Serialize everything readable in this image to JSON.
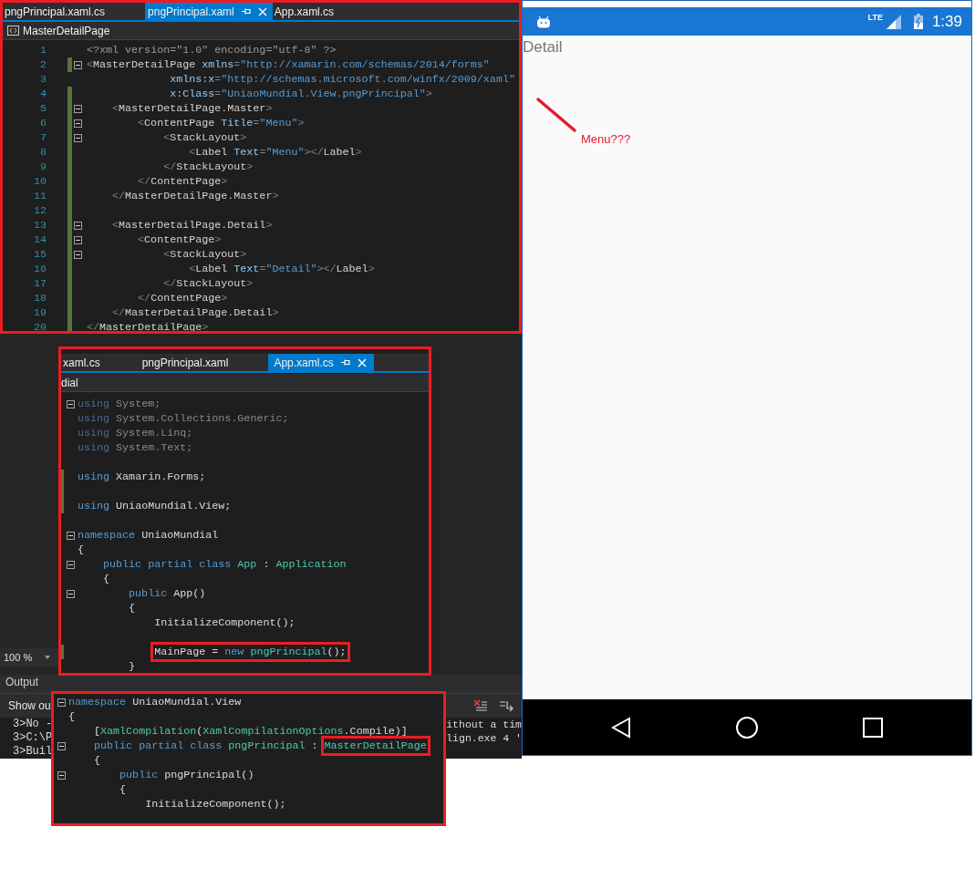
{
  "editors": [
    {
      "tabs": [
        {
          "label": "pngPrincipal.xaml.cs",
          "selected": false
        },
        {
          "label": "pngPrincipal.xaml",
          "selected": true
        },
        {
          "label": "App.xaml.cs",
          "selected": false
        }
      ],
      "breadcrumb": {
        "label": "MasterDetailPage",
        "icon": true
      },
      "lines": [
        {
          "number": "1",
          "fold": false,
          "changed": false,
          "tokens": [
            {
              "kind": "decl",
              "text": "<?xml version=\"1.0\" encoding=\"utf-8\" ?>"
            }
          ]
        },
        {
          "number": "2",
          "fold": true,
          "changed": true,
          "tokens": [
            {
              "kind": "punct",
              "text": "<"
            },
            {
              "kind": "tag",
              "text": "MasterDetailPage"
            },
            {
              "kind": "attr",
              "text": " xmlns"
            },
            {
              "kind": "punct",
              "text": "="
            },
            {
              "kind": "string",
              "text": "\"http://xamarin.com/schemas/2014/forms\""
            }
          ]
        },
        {
          "number": "3",
          "fold": false,
          "changed": false,
          "tokens": [
            {
              "kind": "attr",
              "text": "             xmlns:x"
            },
            {
              "kind": "punct",
              "text": "="
            },
            {
              "kind": "string",
              "text": "\"http://schemas.microsoft.com/winfx/2009/xaml\""
            }
          ]
        },
        {
          "number": "4",
          "fold": false,
          "changed": true,
          "tokens": [
            {
              "kind": "attr",
              "text": "             x:Class"
            },
            {
              "kind": "punct",
              "text": "="
            },
            {
              "kind": "string",
              "text": "\"UniaoMundial.View.pngPrincipal\""
            },
            {
              "kind": "punct",
              "text": ">"
            }
          ]
        },
        {
          "number": "5",
          "fold": true,
          "changed": true,
          "tokens": [
            {
              "kind": "punct",
              "text": "    <"
            },
            {
              "kind": "tag",
              "text": "MasterDetailPage.Master"
            },
            {
              "kind": "punct",
              "text": ">"
            }
          ]
        },
        {
          "number": "6",
          "fold": true,
          "changed": true,
          "tokens": [
            {
              "kind": "punct",
              "text": "        <"
            },
            {
              "kind": "tag",
              "text": "ContentPage"
            },
            {
              "kind": "attr",
              "text": " Title"
            },
            {
              "kind": "punct",
              "text": "="
            },
            {
              "kind": "string",
              "text": "\"Menu\""
            },
            {
              "kind": "punct",
              "text": ">"
            }
          ]
        },
        {
          "number": "7",
          "fold": true,
          "changed": true,
          "tokens": [
            {
              "kind": "punct",
              "text": "            <"
            },
            {
              "kind": "tag",
              "text": "StackLayout"
            },
            {
              "kind": "punct",
              "text": ">"
            }
          ]
        },
        {
          "number": "8",
          "fold": false,
          "changed": true,
          "tokens": [
            {
              "kind": "punct",
              "text": "                <"
            },
            {
              "kind": "tag",
              "text": "Label"
            },
            {
              "kind": "attr",
              "text": " Text"
            },
            {
              "kind": "punct",
              "text": "="
            },
            {
              "kind": "string",
              "text": "\"Menu\""
            },
            {
              "kind": "punct",
              "text": "></"
            },
            {
              "kind": "tag",
              "text": "Label"
            },
            {
              "kind": "punct",
              "text": ">"
            }
          ]
        },
        {
          "number": "9",
          "fold": false,
          "changed": true,
          "tokens": [
            {
              "kind": "punct",
              "text": "            </"
            },
            {
              "kind": "tag",
              "text": "StackLayout"
            },
            {
              "kind": "punct",
              "text": ">"
            }
          ]
        },
        {
          "number": "10",
          "fold": false,
          "changed": true,
          "tokens": [
            {
              "kind": "punct",
              "text": "        </"
            },
            {
              "kind": "tag",
              "text": "ContentPage"
            },
            {
              "kind": "punct",
              "text": ">"
            }
          ]
        },
        {
          "number": "11",
          "fold": false,
          "changed": true,
          "tokens": [
            {
              "kind": "punct",
              "text": "    </"
            },
            {
              "kind": "tag",
              "text": "MasterDetailPage.Master"
            },
            {
              "kind": "punct",
              "text": ">"
            }
          ]
        },
        {
          "number": "12",
          "fold": false,
          "changed": true
        },
        {
          "number": "13",
          "fold": true,
          "changed": true,
          "tokens": [
            {
              "kind": "punct",
              "text": "    <"
            },
            {
              "kind": "tag",
              "text": "MasterDetailPage.Detail"
            },
            {
              "kind": "punct",
              "text": ">"
            }
          ]
        },
        {
          "number": "14",
          "fold": true,
          "changed": true,
          "tokens": [
            {
              "kind": "punct",
              "text": "        <"
            },
            {
              "kind": "tag",
              "text": "ContentPage"
            },
            {
              "kind": "punct",
              "text": ">"
            }
          ]
        },
        {
          "number": "15",
          "fold": true,
          "changed": true,
          "tokens": [
            {
              "kind": "punct",
              "text": "            <"
            },
            {
              "kind": "tag",
              "text": "StackLayout"
            },
            {
              "kind": "punct",
              "text": ">"
            }
          ]
        },
        {
          "number": "16",
          "fold": false,
          "changed": true,
          "tokens": [
            {
              "kind": "punct",
              "text": "                <"
            },
            {
              "kind": "tag",
              "text": "Label"
            },
            {
              "kind": "attr",
              "text": " Text"
            },
            {
              "kind": "punct",
              "text": "="
            },
            {
              "kind": "string",
              "text": "\"Detail\""
            },
            {
              "kind": "punct",
              "text": "></"
            },
            {
              "kind": "tag",
              "text": "Label"
            },
            {
              "kind": "punct",
              "text": ">"
            }
          ]
        },
        {
          "number": "17",
          "fold": false,
          "changed": true,
          "tokens": [
            {
              "kind": "punct",
              "text": "            </"
            },
            {
              "kind": "tag",
              "text": "StackLayout"
            },
            {
              "kind": "punct",
              "text": ">"
            }
          ]
        },
        {
          "number": "18",
          "fold": false,
          "changed": true,
          "tokens": [
            {
              "kind": "punct",
              "text": "        </"
            },
            {
              "kind": "tag",
              "text": "ContentPage"
            },
            {
              "kind": "punct",
              "text": ">"
            }
          ]
        },
        {
          "number": "19",
          "fold": false,
          "changed": true,
          "tokens": [
            {
              "kind": "punct",
              "text": "    </"
            },
            {
              "kind": "tag",
              "text": "MasterDetailPage.Detail"
            },
            {
              "kind": "punct",
              "text": ">"
            }
          ]
        },
        {
          "number": "20",
          "fold": false,
          "changed": true,
          "tokens": [
            {
              "kind": "punct",
              "text": "</"
            },
            {
              "kind": "tag",
              "text": "MasterDetailPage"
            },
            {
              "kind": "punct",
              "text": ">"
            }
          ]
        }
      ]
    },
    {
      "tabs": [
        {
          "label": "xaml.cs",
          "selected": false
        },
        {
          "label": "pngPrincipal.xaml",
          "selected": false
        },
        {
          "label": "App.xaml.cs",
          "selected": true
        }
      ],
      "breadcrumb": {
        "label": "dial",
        "icon": false
      },
      "lines": [
        {
          "fold": true,
          "changed": false,
          "tokens": [
            {
              "kind": "faded_keyword",
              "text": "using"
            },
            {
              "kind": "faded_plain",
              "text": " System;"
            }
          ]
        },
        {
          "fold": false,
          "changed": false,
          "tokens": [
            {
              "kind": "faded_keyword",
              "text": "using"
            },
            {
              "kind": "faded_plain",
              "text": " System.Collections.Generic;"
            }
          ]
        },
        {
          "fold": false,
          "changed": false,
          "tokens": [
            {
              "kind": "faded_keyword",
              "text": "using"
            },
            {
              "kind": "faded_plain",
              "text": " System.Linq;"
            }
          ]
        },
        {
          "fold": false,
          "changed": false,
          "tokens": [
            {
              "kind": "faded_keyword",
              "text": "using"
            },
            {
              "kind": "faded_plain",
              "text": " System.Text;"
            }
          ]
        },
        {
          "fold": false,
          "changed": false
        },
        {
          "fold": false,
          "changed": true,
          "tokens": [
            {
              "kind": "keyword",
              "text": "using"
            },
            {
              "kind": "plain",
              "text": " Xamarin.Forms;"
            }
          ]
        },
        {
          "fold": false,
          "changed": true
        },
        {
          "fold": false,
          "changed": true,
          "tokens": [
            {
              "kind": "keyword",
              "text": "using"
            },
            {
              "kind": "plain",
              "text": " UniaoMundial.View;"
            }
          ]
        },
        {
          "fold": false,
          "changed": false
        },
        {
          "fold": true,
          "changed": false,
          "tokens": [
            {
              "kind": "keyword",
              "text": "namespace"
            },
            {
              "kind": "plain",
              "text": " UniaoMundial"
            }
          ]
        },
        {
          "fold": false,
          "changed": false,
          "tokens": [
            {
              "kind": "plain",
              "text": "{"
            }
          ]
        },
        {
          "fold": true,
          "changed": false,
          "tokens": [
            {
              "kind": "keyword",
              "text": "    public partial class "
            },
            {
              "kind": "type",
              "text": "App"
            },
            {
              "kind": "plain",
              "text": " : "
            },
            {
              "kind": "type",
              "text": "Application"
            }
          ]
        },
        {
          "fold": false,
          "changed": false,
          "tokens": [
            {
              "kind": "plain",
              "text": "    {"
            }
          ]
        },
        {
          "fold": true,
          "changed": false,
          "tokens": [
            {
              "kind": "keyword",
              "text": "        public"
            },
            {
              "kind": "plain",
              "text": " App()"
            }
          ]
        },
        {
          "fold": false,
          "changed": false,
          "tokens": [
            {
              "kind": "plain",
              "text": "        {"
            }
          ]
        },
        {
          "fold": false,
          "changed": false,
          "tokens": [
            {
              "kind": "plain",
              "text": "            InitializeComponent();"
            }
          ]
        },
        {
          "fold": false,
          "changed": false
        },
        {
          "fold": false,
          "changed": true,
          "tokens": [
            {
              "kind": "plain",
              "text": "            MainPage = ",
              "box": true
            },
            {
              "kind": "keyword",
              "text": "new ",
              "box": true
            },
            {
              "kind": "type",
              "text": "pngPrincipal",
              "box": true
            },
            {
              "kind": "plain",
              "text": "();",
              "box": true
            }
          ]
        },
        {
          "fold": false,
          "changed": false,
          "tokens": [
            {
              "kind": "plain",
              "text": "        }"
            }
          ]
        }
      ]
    },
    {
      "lines": [
        {
          "fold": true,
          "changed": false,
          "tokens": [
            {
              "kind": "keyword",
              "text": "namespace"
            },
            {
              "kind": "plain",
              "text": " UniaoMundial.View"
            }
          ]
        },
        {
          "fold": false,
          "changed": false,
          "tokens": [
            {
              "kind": "plain",
              "text": "{"
            }
          ]
        },
        {
          "fold": false,
          "changed": false,
          "tokens": [
            {
              "kind": "plain",
              "text": "    ["
            },
            {
              "kind": "type",
              "text": "XamlCompilation"
            },
            {
              "kind": "plain",
              "text": "("
            },
            {
              "kind": "type",
              "text": "XamlCompilationOptions"
            },
            {
              "kind": "plain",
              "text": ".Compile)]"
            }
          ]
        },
        {
          "fold": true,
          "changed": false,
          "tokens": [
            {
              "kind": "keyword",
              "text": "    public partial class "
            },
            {
              "kind": "type",
              "text": "pngPrincipal"
            },
            {
              "kind": "plain",
              "text": " : "
            },
            {
              "kind": "type",
              "text": "MasterDetailPage",
              "box": true
            }
          ]
        },
        {
          "fold": false,
          "changed": false,
          "tokens": [
            {
              "kind": "plain",
              "text": "    {"
            }
          ]
        },
        {
          "fold": true,
          "changed": false,
          "tokens": [
            {
              "kind": "keyword",
              "text": "        public"
            },
            {
              "kind": "plain",
              "text": " pngPrincipal()"
            }
          ]
        },
        {
          "fold": false,
          "changed": false,
          "tokens": [
            {
              "kind": "plain",
              "text": "        {"
            }
          ]
        },
        {
          "fold": false,
          "changed": false,
          "tokens": [
            {
              "kind": "plain",
              "text": "            InitializeComponent();"
            }
          ]
        }
      ]
    }
  ],
  "zoom_level": "100 %",
  "output_panel": {
    "title": "Output",
    "show_label": "Show ou",
    "log_lines": [
      "3>No -",
      "3>C:\\P",
      "3>Buil"
    ],
    "log_line_ends": [
      "ithout a tim",
      "lign.exe 4 '"
    ]
  },
  "phone": {
    "network": "LTE",
    "time": "1:39",
    "detail_label": "Detail",
    "annotation": "Menu???"
  }
}
